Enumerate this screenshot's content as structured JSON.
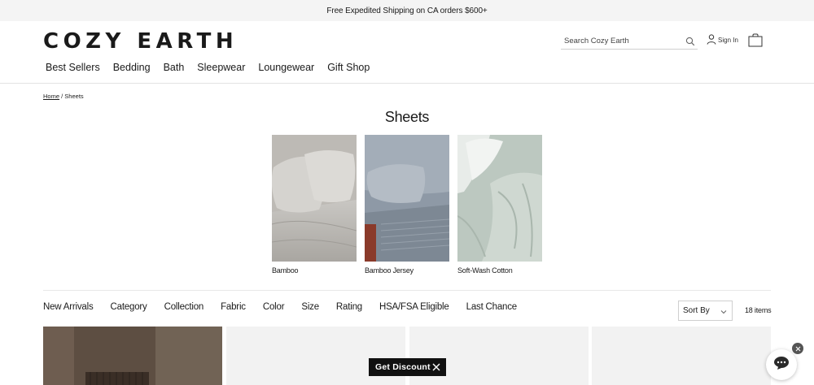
{
  "promo": {
    "text": "Free Expedited Shipping on CA orders $600+"
  },
  "brand": {
    "name": "COZY EARTH"
  },
  "header": {
    "search_placeholder": "Search Cozy Earth",
    "signin_label": "Sign In",
    "icons": {
      "search": "search-icon",
      "user": "user-icon",
      "cart": "bag-icon"
    }
  },
  "nav": {
    "items": [
      "Best Sellers",
      "Bedding",
      "Bath",
      "Sleepwear",
      "Loungewear",
      "Gift Shop"
    ]
  },
  "breadcrumb": {
    "home": "Home",
    "separator": "/",
    "current": "Sheets"
  },
  "page": {
    "title": "Sheets"
  },
  "categories": [
    {
      "label": "Bamboo"
    },
    {
      "label": "Bamboo Jersey"
    },
    {
      "label": "Soft-Wash Cotton"
    }
  ],
  "filters": [
    "New Arrivals",
    "Category",
    "Collection",
    "Fabric",
    "Color",
    "Size",
    "Rating",
    "HSA/FSA Eligible",
    "Last Chance"
  ],
  "sort": {
    "label": "Sort By",
    "icon": "chevron-down-icon"
  },
  "results": {
    "count_text": "18 items"
  },
  "discount": {
    "label": "Get Discount",
    "icon": "close-icon"
  },
  "chat": {
    "icon": "chat-icon",
    "close_icon": "close-icon"
  },
  "colors": {
    "text": "#1a1a1a",
    "promo_bg": "#f4f4f4",
    "card_bg": "#f2f2f2",
    "discount_bg": "#111111"
  }
}
